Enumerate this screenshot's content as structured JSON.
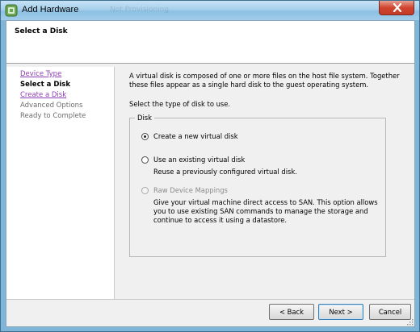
{
  "window": {
    "title": "Add Hardware",
    "background_ghost_text": "Not Provisioning",
    "close_label": "close"
  },
  "header": {
    "title": "Select a Disk"
  },
  "sidebar": {
    "items": [
      {
        "label": "Device Type",
        "state": "link"
      },
      {
        "label": "Select a Disk",
        "state": "current"
      },
      {
        "label": "Create a Disk",
        "state": "link"
      },
      {
        "label": "Advanced Options",
        "state": "disabled"
      },
      {
        "label": "Ready to Complete",
        "state": "disabled"
      }
    ]
  },
  "main": {
    "description": "A virtual disk is composed of one or more files on the host file system. Together these files appear as a single hard disk to the guest operating system.",
    "prompt": "Select the type of disk to use.",
    "group_label": "Disk",
    "options": [
      {
        "label": "Create a new virtual disk",
        "selected": true,
        "enabled": true,
        "description": ""
      },
      {
        "label": "Use an existing virtual disk",
        "selected": false,
        "enabled": true,
        "description": "Reuse a previously configured virtual disk."
      },
      {
        "label": "Raw Device Mappings",
        "selected": false,
        "enabled": false,
        "description": "Give your virtual machine direct access to SAN. This option allows you to use existing SAN commands to manage the storage and continue to access it using a datastore."
      }
    ]
  },
  "footer": {
    "back_label": "< Back",
    "next_label": "Next >",
    "cancel_label": "Cancel"
  },
  "colors": {
    "title_bar": "#a7d0ec",
    "link": "#8b3fb3",
    "close_button": "#d1452f"
  }
}
